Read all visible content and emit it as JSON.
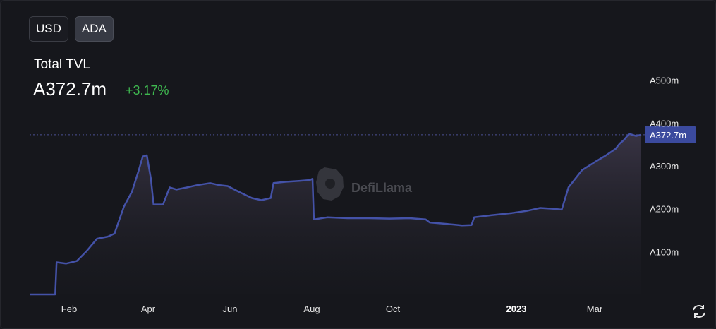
{
  "toggles": [
    {
      "label": "USD",
      "active": false
    },
    {
      "label": "ADA",
      "active": true
    }
  ],
  "header": {
    "title": "Total TVL",
    "value": "A372.7m",
    "change": "+3.17%"
  },
  "watermark": "DefiLlama",
  "colors": {
    "line": "#4452a8",
    "change_positive": "#3fb950",
    "current_label_bg": "#3b4a9e"
  },
  "chart_data": {
    "type": "area",
    "x_tick_labels": [
      "Feb",
      "Apr",
      "Jun",
      "Aug",
      "Oct",
      "2023",
      "Mar"
    ],
    "y_tick_labels": [
      "A100m",
      "A200m",
      "A300m",
      "A400m",
      "A500m"
    ],
    "y_ticks": [
      100,
      200,
      300,
      400,
      500
    ],
    "ylim": [
      0,
      500
    ],
    "xlim": [
      "2022-01-01",
      "2023-03-31"
    ],
    "current_value": 372.7,
    "current_value_label": "A372.7m",
    "y_unit": "ADA millions",
    "grid": false,
    "series": [
      {
        "x": [
          "2022-01-01",
          "2022-01-20",
          "2022-01-21",
          "2022-01-28",
          "2022-02-05",
          "2022-02-12",
          "2022-02-20",
          "2022-02-28",
          "2022-03-05",
          "2022-03-12",
          "2022-03-18",
          "2022-03-23",
          "2022-03-26",
          "2022-03-29",
          "2022-04-01",
          "2022-04-03",
          "2022-04-10",
          "2022-04-15",
          "2022-04-20",
          "2022-04-28",
          "2022-05-05",
          "2022-05-15",
          "2022-05-22",
          "2022-05-28",
          "2022-06-05",
          "2022-06-15",
          "2022-06-22",
          "2022-06-29",
          "2022-07-01",
          "2022-07-10",
          "2022-07-20",
          "2022-07-28",
          "2022-07-30",
          "2022-07-31",
          "2022-08-10",
          "2022-08-25",
          "2022-09-10",
          "2022-09-25",
          "2022-10-10",
          "2022-10-22",
          "2022-10-25",
          "2022-11-05",
          "2022-11-12",
          "2022-11-18",
          "2022-11-25",
          "2022-11-27",
          "2022-12-10",
          "2022-12-25",
          "2023-01-05",
          "2023-01-15",
          "2023-01-25",
          "2023-01-31",
          "2023-02-05",
          "2023-02-15",
          "2023-02-25",
          "2023-03-05",
          "2023-03-12",
          "2023-03-15",
          "2023-03-18",
          "2023-03-22",
          "2023-03-27",
          "2023-03-31"
        ],
        "values": [
          0,
          0,
          75,
          72,
          78,
          100,
          130,
          135,
          142,
          205,
          240,
          290,
          322,
          325,
          270,
          210,
          210,
          250,
          245,
          250,
          255,
          260,
          255,
          253,
          240,
          225,
          220,
          225,
          260,
          263,
          265,
          267,
          270,
          175,
          180,
          178,
          178,
          177,
          178,
          175,
          168,
          165,
          163,
          161,
          162,
          180,
          185,
          190,
          195,
          202,
          200,
          198,
          250,
          290,
          310,
          325,
          340,
          352,
          360,
          375,
          370,
          372.7
        ]
      }
    ]
  }
}
